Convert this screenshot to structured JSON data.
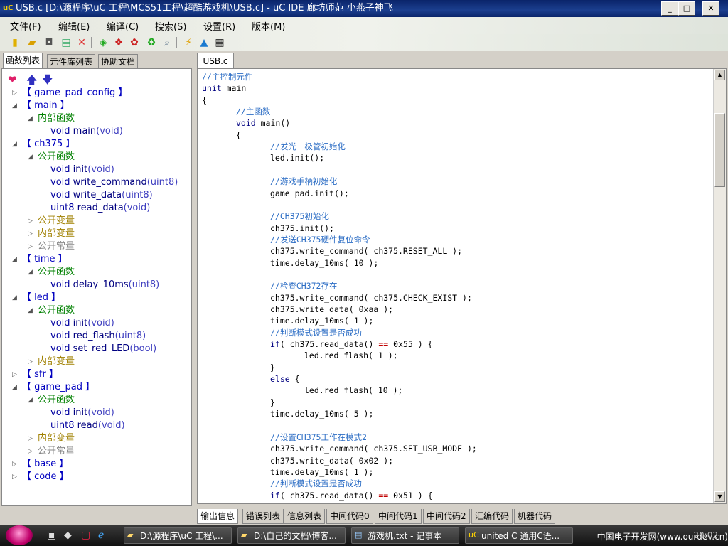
{
  "window": {
    "title": "USB.c [D:\\源程序\\uC 工程\\MCS51工程\\超酷游戏机\\USB.c]  -  uC IDE 廊坊师范 小燕子神飞",
    "app_icon_text": "uC",
    "buttons": {
      "minimize": "_",
      "maximize": "□",
      "close": "✕"
    }
  },
  "menu": [
    "文件(F)",
    "编辑(E)",
    "编译(C)",
    "搜索(S)",
    "设置(R)",
    "版本(M)"
  ],
  "toolbar_icons": [
    "new-file-icon",
    "open-folder-icon",
    "save-icon",
    "print-icon",
    "delete-icon",
    "compile-icon",
    "build-icon",
    "rebuild-icon",
    "refresh-icon",
    "find-icon",
    "flash-icon",
    "warning-icon",
    "chip-icon"
  ],
  "left_tabs": [
    "函数列表",
    "元件库列表",
    "协助文档"
  ],
  "tree": [
    {
      "t": "【 game_pad_config 】",
      "cls": "mod",
      "lvl": 0,
      "exp": "closed"
    },
    {
      "t": "【 main 】",
      "cls": "mod",
      "lvl": 0,
      "exp": "open"
    },
    {
      "t": "内部函数",
      "cls": "group",
      "lvl": 1,
      "exp": "open"
    },
    {
      "kw": "void",
      "t": "main",
      "params": "(void)",
      "cls": "fn",
      "lvl": 2
    },
    {
      "t": "【 ch375 】",
      "cls": "mod",
      "lvl": 0,
      "exp": "open"
    },
    {
      "t": "公开函数",
      "cls": "group",
      "lvl": 1,
      "exp": "open"
    },
    {
      "kw": "void",
      "t": "init",
      "params": "(void)",
      "cls": "fn",
      "lvl": 2
    },
    {
      "kw": "void",
      "t": "write_command",
      "params": "(uint8)",
      "cls": "fn",
      "lvl": 2
    },
    {
      "kw": "void",
      "t": "write_data",
      "params": "(uint8)",
      "cls": "fn",
      "lvl": 2
    },
    {
      "kw": "uint8",
      "t": "read_data",
      "params": "(void)",
      "cls": "fn",
      "lvl": 2
    },
    {
      "t": "公开变量",
      "cls": "group-pv",
      "lvl": 1,
      "exp": "closed"
    },
    {
      "t": "内部变量",
      "cls": "group-pv",
      "lvl": 1,
      "exp": "closed"
    },
    {
      "t": "公开常量",
      "cls": "group-gray",
      "lvl": 1,
      "exp": "closed"
    },
    {
      "t": "【 time 】",
      "cls": "mod",
      "lvl": 0,
      "exp": "open"
    },
    {
      "t": "公开函数",
      "cls": "group",
      "lvl": 1,
      "exp": "open"
    },
    {
      "kw": "void",
      "t": "delay_10ms",
      "params": "(uint8)",
      "cls": "fn",
      "lvl": 2
    },
    {
      "t": "【 led 】",
      "cls": "mod",
      "lvl": 0,
      "exp": "open"
    },
    {
      "t": "公开函数",
      "cls": "group",
      "lvl": 1,
      "exp": "open"
    },
    {
      "kw": "void",
      "t": "init",
      "params": "(void)",
      "cls": "fn",
      "lvl": 2
    },
    {
      "kw": "void",
      "t": "red_flash",
      "params": "(uint8)",
      "cls": "fn",
      "lvl": 2
    },
    {
      "kw": "void",
      "t": "set_red_LED",
      "params": "(bool)",
      "cls": "fn",
      "lvl": 2
    },
    {
      "t": "内部变量",
      "cls": "group-pv",
      "lvl": 1,
      "exp": "closed"
    },
    {
      "t": "【 sfr 】",
      "cls": "mod",
      "lvl": 0,
      "exp": "closed"
    },
    {
      "t": "【 game_pad 】",
      "cls": "mod",
      "lvl": 0,
      "exp": "open"
    },
    {
      "t": "公开函数",
      "cls": "group",
      "lvl": 1,
      "exp": "open"
    },
    {
      "kw": "void",
      "t": "init",
      "params": "(void)",
      "cls": "fn",
      "lvl": 2
    },
    {
      "kw": "uint8",
      "t": "read",
      "params": "(void)",
      "cls": "fn",
      "lvl": 2
    },
    {
      "t": "内部变量",
      "cls": "group-pv",
      "lvl": 1,
      "exp": "closed"
    },
    {
      "t": "公开常量",
      "cls": "group-gray",
      "lvl": 1,
      "exp": "closed"
    },
    {
      "t": "【 base 】",
      "cls": "mod",
      "lvl": 0,
      "exp": "closed"
    },
    {
      "t": "【 code 】",
      "cls": "mod",
      "lvl": 0,
      "exp": "closed"
    }
  ],
  "editor": {
    "tab": "USB.c",
    "lines": [
      {
        "ind": 0,
        "s": [
          [
            "cm",
            "//主控制元件"
          ]
        ]
      },
      {
        "ind": 0,
        "s": [
          [
            "kw",
            "unit"
          ],
          [
            "id",
            " main"
          ]
        ]
      },
      {
        "ind": 0,
        "s": [
          [
            "id",
            "{"
          ]
        ]
      },
      {
        "ind": 1,
        "s": [
          [
            "cm",
            "//主函数"
          ]
        ]
      },
      {
        "ind": 1,
        "s": [
          [
            "kw",
            "void"
          ],
          [
            "id",
            " main()"
          ]
        ]
      },
      {
        "ind": 1,
        "s": [
          [
            "id",
            "{"
          ]
        ]
      },
      {
        "ind": 2,
        "s": [
          [
            "cm",
            "//发光二极管初始化"
          ]
        ]
      },
      {
        "ind": 2,
        "s": [
          [
            "id",
            "led.init();"
          ]
        ]
      },
      {
        "ind": 2,
        "s": []
      },
      {
        "ind": 2,
        "s": [
          [
            "cm",
            "//游戏手柄初始化"
          ]
        ]
      },
      {
        "ind": 2,
        "s": [
          [
            "id",
            "game_pad.init();"
          ]
        ]
      },
      {
        "ind": 2,
        "s": []
      },
      {
        "ind": 2,
        "s": [
          [
            "cm",
            "//CH375初始化"
          ]
        ]
      },
      {
        "ind": 2,
        "s": [
          [
            "id",
            "ch375.init();"
          ]
        ]
      },
      {
        "ind": 2,
        "s": [
          [
            "cm",
            "//发送CH375硬件复位命令"
          ]
        ]
      },
      {
        "ind": 2,
        "s": [
          [
            "id",
            "ch375.write_command( ch375.RESET_ALL );"
          ]
        ]
      },
      {
        "ind": 2,
        "s": [
          [
            "id",
            "time.delay_10ms( 10 );"
          ]
        ]
      },
      {
        "ind": 2,
        "s": []
      },
      {
        "ind": 2,
        "s": [
          [
            "cm",
            "//检查CH372存在"
          ]
        ]
      },
      {
        "ind": 2,
        "s": [
          [
            "id",
            "ch375.write_command( ch375.CHECK_EXIST );"
          ]
        ]
      },
      {
        "ind": 2,
        "s": [
          [
            "id",
            "ch375.write_data( 0xaa );"
          ]
        ]
      },
      {
        "ind": 2,
        "s": [
          [
            "id",
            "time.delay_10ms( 1 );"
          ]
        ]
      },
      {
        "ind": 2,
        "s": [
          [
            "cm",
            "//判断模式设置是否成功"
          ]
        ]
      },
      {
        "ind": 2,
        "s": [
          [
            "kw",
            "if"
          ],
          [
            "id",
            "( ch375.read_data() "
          ],
          [
            "op",
            "=="
          ],
          [
            "id",
            " 0x55 ) {"
          ]
        ]
      },
      {
        "ind": 3,
        "s": [
          [
            "id",
            "led.red_flash( 1 );"
          ]
        ]
      },
      {
        "ind": 2,
        "s": [
          [
            "id",
            "}"
          ]
        ]
      },
      {
        "ind": 2,
        "s": [
          [
            "kw",
            "else"
          ],
          [
            "id",
            " {"
          ]
        ]
      },
      {
        "ind": 3,
        "s": [
          [
            "id",
            "led.red_flash( 10 );"
          ]
        ]
      },
      {
        "ind": 2,
        "s": [
          [
            "id",
            "}"
          ]
        ]
      },
      {
        "ind": 2,
        "s": [
          [
            "id",
            "time.delay_10ms( 5 );"
          ]
        ]
      },
      {
        "ind": 2,
        "s": []
      },
      {
        "ind": 2,
        "s": [
          [
            "cm",
            "//设置CH375工作在模式2"
          ]
        ]
      },
      {
        "ind": 2,
        "s": [
          [
            "id",
            "ch375.write_command( ch375.SET_USB_MODE );"
          ]
        ]
      },
      {
        "ind": 2,
        "s": [
          [
            "id",
            "ch375.write_data( 0x02 );"
          ]
        ]
      },
      {
        "ind": 2,
        "s": [
          [
            "id",
            "time.delay_10ms( 1 );"
          ]
        ]
      },
      {
        "ind": 2,
        "s": [
          [
            "cm",
            "//判断模式设置是否成功"
          ]
        ]
      },
      {
        "ind": 2,
        "s": [
          [
            "kw",
            "if"
          ],
          [
            "id",
            "( ch375.read_data() "
          ],
          [
            "op",
            "=="
          ],
          [
            "id",
            " 0x51 ) {"
          ]
        ]
      }
    ]
  },
  "bottom_tabs": [
    "输出信息",
    "错误列表",
    "信息列表",
    "中间代码0",
    "中间代码1",
    "中间代码2",
    "汇编代码",
    "机器代码"
  ],
  "taskbar": {
    "tasks": [
      "D:\\源程序\\uC 工程\\...",
      "D:\\自己的文档\\博客...",
      "游戏机.txt - 记事本",
      "united C   通用C语..."
    ],
    "tray_text": "中国电子开发网(www.ourdev.cn)",
    "clock": "20:02"
  },
  "colors": {
    "title": "#0a246a",
    "comment": "#2d6ec5",
    "keyword": "#000080",
    "operator": "#c00000",
    "module": "#0000c0",
    "group": "#008000"
  }
}
